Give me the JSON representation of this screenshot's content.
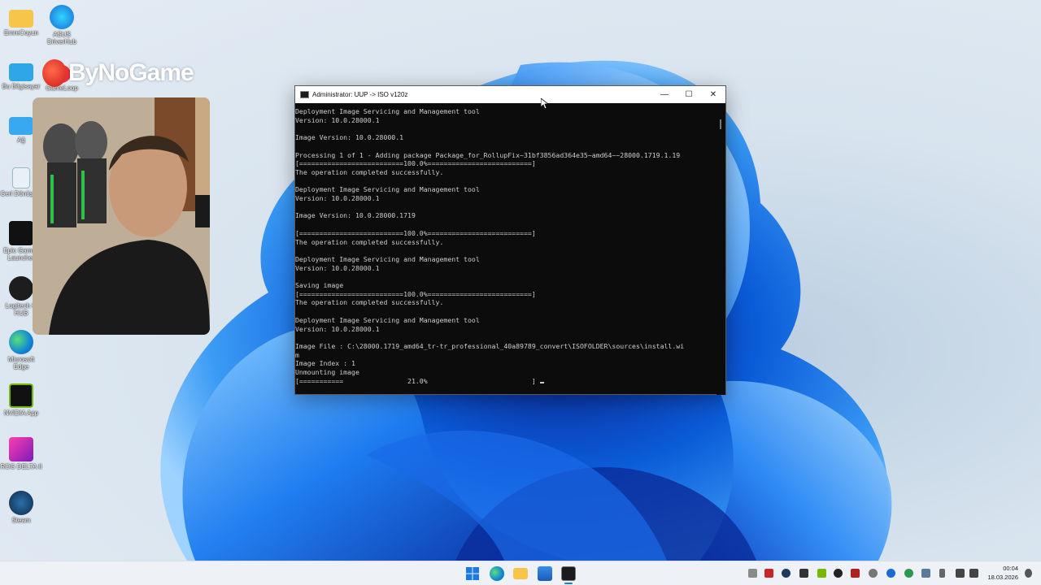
{
  "desktop": {
    "icons": [
      {
        "label": "EmreCoyun"
      },
      {
        "label": "ASUS DriverHub"
      },
      {
        "label": "Bu Bilgisayar"
      },
      {
        "label": "GameLoop"
      },
      {
        "label": "Ağ"
      },
      {
        "label": "Geri Dönüşü..."
      },
      {
        "label": "Epic Games Launcher"
      },
      {
        "label": "Logitech G HUB"
      },
      {
        "label": "Microsoft Edge"
      },
      {
        "label": "NVIDIA App"
      },
      {
        "label": "ROG DELTA II"
      },
      {
        "label": "Steam"
      }
    ],
    "brand": "ByNoGame"
  },
  "cmd": {
    "title": "Administrator:  UUP -> ISO v120z",
    "lines": [
      "Deployment Image Servicing and Management tool",
      "Version: 10.0.28000.1",
      "",
      "Image Version: 10.0.28000.1",
      "",
      "Processing 1 of 1 - Adding package Package_for_RollupFix~31bf3856ad364e35~amd64~~28000.1719.1.19",
      "[==========================100.0%==========================]",
      "The operation completed successfully.",
      "",
      "Deployment Image Servicing and Management tool",
      "Version: 10.0.28000.1",
      "",
      "Image Version: 10.0.28000.1719",
      "",
      "[==========================100.0%==========================]",
      "The operation completed successfully.",
      "",
      "Deployment Image Servicing and Management tool",
      "Version: 10.0.28000.1",
      "",
      "Saving image",
      "[==========================100.0%==========================]",
      "The operation completed successfully.",
      "",
      "Deployment Image Servicing and Management tool",
      "Version: 10.0.28000.1",
      "",
      "Image File : C:\\28000.1719_amd64_tr-tr_professional_40a89789_convert\\ISOFOLDER\\sources\\install.wi",
      "m",
      "Image Index : 1",
      "Unmounting image",
      "[===========                21.0%                          ] "
    ],
    "progress": 0.21
  },
  "taskbar": {
    "time": "00:04",
    "date": "18.03.2026"
  }
}
